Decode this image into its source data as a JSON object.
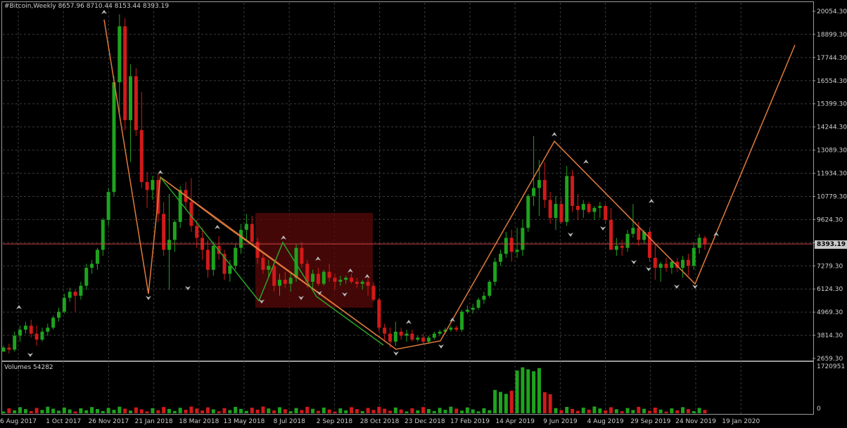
{
  "header": {
    "symbol_info": "#Bitcoin,Weekly  8657.96 8710.44 8153.44 8393.19"
  },
  "volume_panel": {
    "label": "Volumes 54282",
    "max_label": "1720951",
    "zero_label": "0"
  },
  "price_badge": "8393.19",
  "colors": {
    "bull": "#1ea31e",
    "bear": "#d11a1a",
    "trend_orange": "#e07a3c",
    "trend_green": "#2aa52a",
    "grid": "#3a3a3a",
    "zone": "#5a0a0a",
    "price_line": "#d24040"
  },
  "chart_data": {
    "type": "candlestick",
    "y_axis_ticks": [
      "20054.30",
      "18899.30",
      "17744.30",
      "16554.30",
      "15399.30",
      "14244.30",
      "13089.30",
      "11934.30",
      "10779.30",
      "9624.30",
      "8393.19",
      "7279.30",
      "6124.30",
      "4969.30",
      "3814.30",
      "2659.30"
    ],
    "x_axis_ticks": [
      "6 Aug 2017",
      "1 Oct 2017",
      "26 Nov 2017",
      "21 Jan 2018",
      "18 Mar 2018",
      "13 May 2018",
      "8 Jul 2018",
      "2 Sep 2018",
      "28 Oct 2018",
      "23 Dec 2018",
      "17 Feb 2019",
      "14 Apr 2019",
      "9 Jun 2019",
      "4 Aug 2019",
      "29 Sep 2019",
      "24 Nov 2019",
      "19 Jan 2020"
    ],
    "ylim": [
      2659.3,
      20054.3
    ],
    "last_close": 8393.19,
    "candles": [
      [
        3000,
        3300,
        3000,
        3200
      ],
      [
        3200,
        3400,
        2900,
        3100
      ],
      [
        3100,
        4000,
        3000,
        3800
      ],
      [
        3800,
        4300,
        3500,
        4100
      ],
      [
        4100,
        4500,
        3900,
        4300
      ],
      [
        4300,
        4600,
        3700,
        3900
      ],
      [
        3900,
        4300,
        3300,
        3600
      ],
      [
        3600,
        4200,
        3500,
        4000
      ],
      [
        4000,
        4400,
        3800,
        4200
      ],
      [
        4200,
        4800,
        4100,
        4700
      ],
      [
        4700,
        5200,
        4500,
        5000
      ],
      [
        5000,
        5900,
        4900,
        5700
      ],
      [
        5700,
        6200,
        5500,
        6000
      ],
      [
        6000,
        6100,
        5000,
        5800
      ],
      [
        5800,
        6500,
        5600,
        6300
      ],
      [
        6300,
        7400,
        6100,
        7200
      ],
      [
        7200,
        7600,
        6900,
        7400
      ],
      [
        7400,
        8200,
        7100,
        8100
      ],
      [
        8100,
        9700,
        7800,
        9600
      ],
      [
        9600,
        11200,
        9300,
        11000
      ],
      [
        11000,
        16800,
        10800,
        16500
      ],
      [
        16500,
        19900,
        15000,
        19300
      ],
      [
        19300,
        19700,
        14100,
        14600
      ],
      [
        14600,
        17400,
        12500,
        16800
      ],
      [
        16800,
        17200,
        13800,
        14100
      ],
      [
        14100,
        16000,
        11200,
        11500
      ],
      [
        11500,
        12000,
        10200,
        11100
      ],
      [
        11100,
        11800,
        10600,
        11600
      ],
      [
        11600,
        11900,
        9500,
        9900
      ],
      [
        9900,
        10500,
        7800,
        8100
      ],
      [
        8100,
        10900,
        6100,
        8600
      ],
      [
        8600,
        9600,
        8000,
        9500
      ],
      [
        9500,
        11300,
        9200,
        11100
      ],
      [
        11100,
        11500,
        10100,
        10500
      ],
      [
        10500,
        11700,
        9000,
        9300
      ],
      [
        9300,
        9600,
        8200,
        8700
      ],
      [
        8700,
        9200,
        7600,
        8100
      ],
      [
        8100,
        8600,
        6700,
        7100
      ],
      [
        7100,
        8500,
        6800,
        8300
      ],
      [
        8300,
        8800,
        7600,
        7900
      ],
      [
        7900,
        8100,
        6600,
        6900
      ],
      [
        6900,
        7600,
        6500,
        7300
      ],
      [
        7300,
        8400,
        7100,
        8200
      ],
      [
        8200,
        9400,
        7900,
        9100
      ],
      [
        9100,
        9900,
        8600,
        9400
      ],
      [
        9400,
        9800,
        8300,
        8500
      ],
      [
        8500,
        8700,
        7400,
        7700
      ],
      [
        7700,
        8000,
        6900,
        7100
      ],
      [
        7100,
        7600,
        6700,
        7300
      ],
      [
        7300,
        7500,
        6000,
        6300
      ],
      [
        6300,
        6900,
        5800,
        6600
      ],
      [
        6600,
        7000,
        6200,
        6400
      ],
      [
        6400,
        6900,
        6000,
        6700
      ],
      [
        6700,
        8400,
        6500,
        8200
      ],
      [
        8200,
        8500,
        7200,
        7400
      ],
      [
        7400,
        7600,
        6200,
        6500
      ],
      [
        6500,
        7100,
        6200,
        6900
      ],
      [
        6900,
        7200,
        6300,
        6400
      ],
      [
        6400,
        7100,
        6300,
        7000
      ],
      [
        7000,
        7400,
        6500,
        6700
      ],
      [
        6700,
        6900,
        6100,
        6500
      ],
      [
        6500,
        6800,
        6300,
        6600
      ],
      [
        6600,
        6800,
        6400,
        6700
      ],
      [
        6700,
        6900,
        6400,
        6500
      ],
      [
        6500,
        6700,
        6200,
        6400
      ],
      [
        6400,
        6600,
        6100,
        6500
      ],
      [
        6500,
        6700,
        5800,
        6300
      ],
      [
        6300,
        6500,
        5500,
        5600
      ],
      [
        5600,
        5700,
        4000,
        4200
      ],
      [
        4200,
        4400,
        3500,
        3900
      ],
      [
        3900,
        4200,
        3200,
        3500
      ],
      [
        3500,
        4500,
        3300,
        4000
      ],
      [
        4000,
        4200,
        3600,
        3800
      ],
      [
        3800,
        4100,
        3500,
        3900
      ],
      [
        3900,
        4100,
        3500,
        3600
      ],
      [
        3600,
        3800,
        3500,
        3700
      ],
      [
        3700,
        3900,
        3400,
        3500
      ],
      [
        3500,
        3800,
        3400,
        3700
      ],
      [
        3700,
        4000,
        3600,
        3900
      ],
      [
        3900,
        4100,
        3800,
        4000
      ],
      [
        4000,
        4200,
        3900,
        4100
      ],
      [
        4100,
        4300,
        4000,
        4200
      ],
      [
        4200,
        4300,
        4000,
        4100
      ],
      [
        4100,
        5100,
        4000,
        5000
      ],
      [
        5000,
        5300,
        4900,
        5100
      ],
      [
        5100,
        5400,
        4900,
        5200
      ],
      [
        5200,
        5700,
        5100,
        5600
      ],
      [
        5600,
        6000,
        5400,
        5800
      ],
      [
        5800,
        6600,
        5700,
        6500
      ],
      [
        6500,
        7700,
        6300,
        7500
      ],
      [
        7500,
        8100,
        7300,
        7900
      ],
      [
        7900,
        9000,
        7700,
        8700
      ],
      [
        8700,
        9100,
        7500,
        8000
      ],
      [
        8000,
        9200,
        7700,
        8100
      ],
      [
        8100,
        9600,
        7800,
        9200
      ],
      [
        9200,
        10900,
        9000,
        10800
      ],
      [
        10800,
        13800,
        10300,
        11200
      ],
      [
        11200,
        12600,
        9800,
        11600
      ],
      [
        11600,
        12500,
        10200,
        10600
      ],
      [
        10600,
        11000,
        9400,
        9700
      ],
      [
        9700,
        10800,
        9100,
        10400
      ],
      [
        10400,
        10700,
        9400,
        9500
      ],
      [
        9500,
        12300,
        9300,
        11800
      ],
      [
        11800,
        12100,
        10000,
        10300
      ],
      [
        10300,
        10900,
        9600,
        10100
      ],
      [
        10100,
        10600,
        9700,
        10400
      ],
      [
        10400,
        10500,
        9900,
        10000
      ],
      [
        10000,
        10300,
        9600,
        10200
      ],
      [
        10200,
        10500,
        9700,
        10300
      ],
      [
        10300,
        10400,
        9400,
        9600
      ],
      [
        9600,
        10200,
        9100,
        8100
      ],
      [
        8100,
        8700,
        7800,
        8300
      ],
      [
        8300,
        8600,
        7800,
        8200
      ],
      [
        8200,
        9100,
        8000,
        8900
      ],
      [
        8900,
        10400,
        8700,
        9200
      ],
      [
        9200,
        9500,
        8300,
        8600
      ],
      [
        8600,
        9100,
        8400,
        9000
      ],
      [
        9000,
        9200,
        7500,
        7700
      ],
      [
        7700,
        8400,
        6600,
        7200
      ],
      [
        7200,
        7500,
        6500,
        7400
      ],
      [
        7400,
        7700,
        7000,
        7200
      ],
      [
        7200,
        7600,
        6900,
        7500
      ],
      [
        7500,
        7700,
        7000,
        7200
      ],
      [
        7200,
        7800,
        6700,
        7600
      ],
      [
        7600,
        7900,
        6800,
        7300
      ],
      [
        7300,
        8500,
        7100,
        8200
      ],
      [
        8200,
        8900,
        7900,
        8700
      ],
      [
        8700,
        8800,
        8100,
        8400
      ]
    ]
  }
}
